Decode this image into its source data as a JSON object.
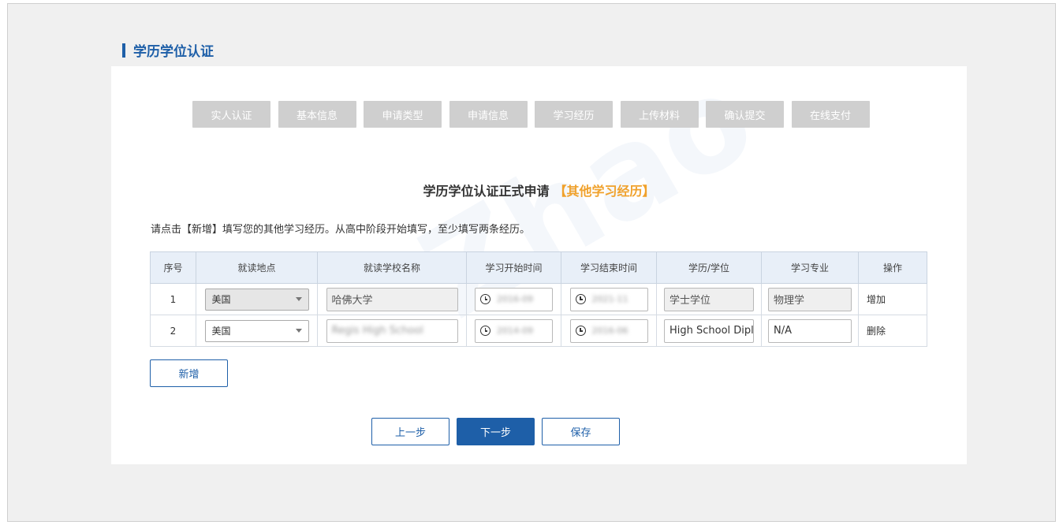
{
  "page": {
    "title": "学历学位认证"
  },
  "steps": [
    "实人认证",
    "基本信息",
    "申请类型",
    "申请信息",
    "学习经历",
    "上传材料",
    "确认提交",
    "在线支付"
  ],
  "form": {
    "heading": "学历学位认证正式申请",
    "heading_accent": "【其他学习经历】",
    "instruction": "请点击【新增】填写您的其他学习经历。从高中阶段开始填写，至少填写两条经历。"
  },
  "table": {
    "headers": [
      "序号",
      "就读地点",
      "就读学校名称",
      "学习开始时间",
      "学习结束时间",
      "学历/学位",
      "学习专业",
      "操作"
    ],
    "rows": [
      {
        "index": "1",
        "location": "美国",
        "school": "哈佛大学",
        "start": "2016-09",
        "end": "2021-11",
        "degree": "学士学位",
        "major": "物理学",
        "action": "增加"
      },
      {
        "index": "2",
        "location": "美国",
        "school": "Regis High School",
        "start": "2014-09",
        "end": "2016-06",
        "degree": "High School Diplo",
        "major": "N/A",
        "action": "删除"
      }
    ]
  },
  "buttons": {
    "add": "新增",
    "prev": "上一步",
    "next": "下一步",
    "save": "保存"
  },
  "watermark": "Zhao",
  "colors": {
    "primary": "#1e5fa8",
    "accent": "#f0a12b",
    "step_bg": "#cfcfcf"
  }
}
